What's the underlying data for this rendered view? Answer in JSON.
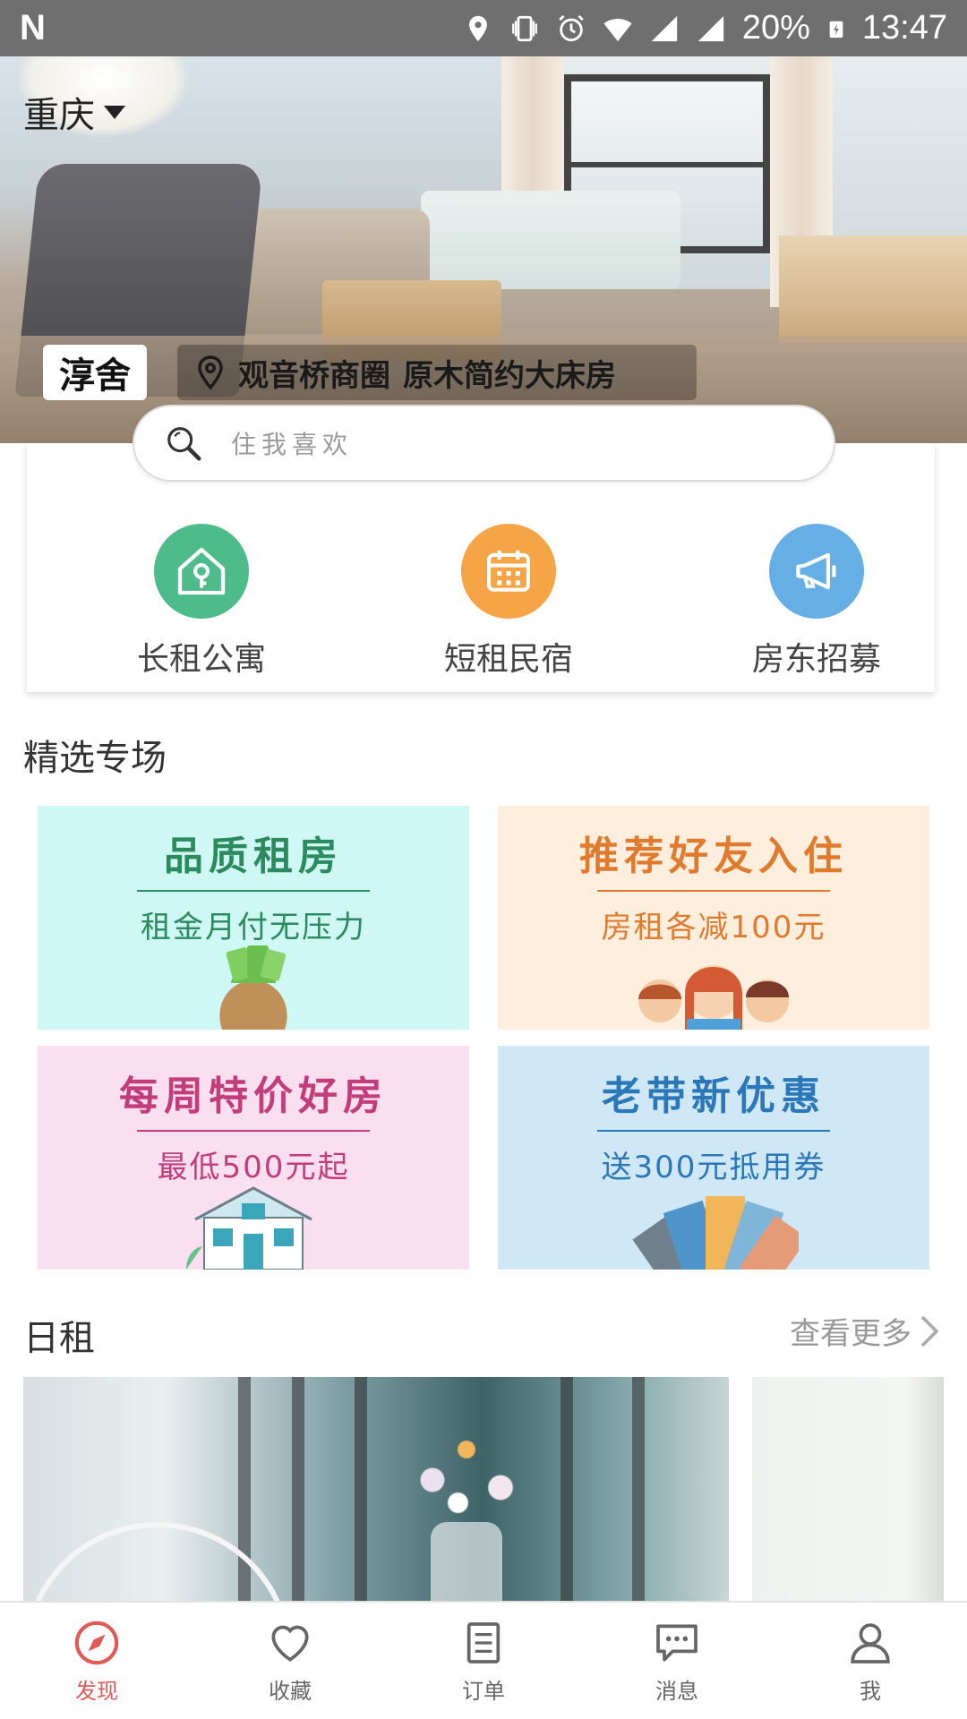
{
  "status_bar": {
    "battery": "20%",
    "time": "13:47"
  },
  "header": {
    "city": "重庆"
  },
  "hero": {
    "brand": "淳舍",
    "location": "观音桥商圈",
    "title": "原木简约大床房"
  },
  "search": {
    "placeholder": "住我喜欢"
  },
  "categories": [
    {
      "label": "长租公寓",
      "color": "#4dbb8a",
      "icon": "house-key-icon"
    },
    {
      "label": "短租民宿",
      "color": "#f5a446",
      "icon": "calendar-icon"
    },
    {
      "label": "房东招募",
      "color": "#66aee6",
      "icon": "megaphone-icon"
    }
  ],
  "featured": {
    "title": "精选专场",
    "cards": [
      {
        "title": "品质租房",
        "subtitle": "租金月付无压力",
        "bg": "#cff7f3",
        "color": "#2b8a5e"
      },
      {
        "title": "推荐好友入住",
        "subtitle": "房租各减100元",
        "bg": "#fdeedd",
        "color": "#e07b2e"
      },
      {
        "title": "每周特价好房",
        "subtitle": "最低500元起",
        "bg": "#f9dff0",
        "color": "#c23d7a"
      },
      {
        "title": "老带新优惠",
        "subtitle": "送300元抵用券",
        "bg": "#d0e8f6",
        "color": "#2b78b9"
      }
    ]
  },
  "daily": {
    "title": "日租",
    "more": "查看更多"
  },
  "nav": {
    "items": [
      {
        "label": "发现",
        "icon": "compass-icon",
        "active": true
      },
      {
        "label": "收藏",
        "icon": "heart-icon",
        "active": false
      },
      {
        "label": "订单",
        "icon": "order-list-icon",
        "active": false
      },
      {
        "label": "消息",
        "icon": "message-icon",
        "active": false
      },
      {
        "label": "我",
        "icon": "user-icon",
        "active": false
      }
    ],
    "active_color": "#e05a57"
  }
}
